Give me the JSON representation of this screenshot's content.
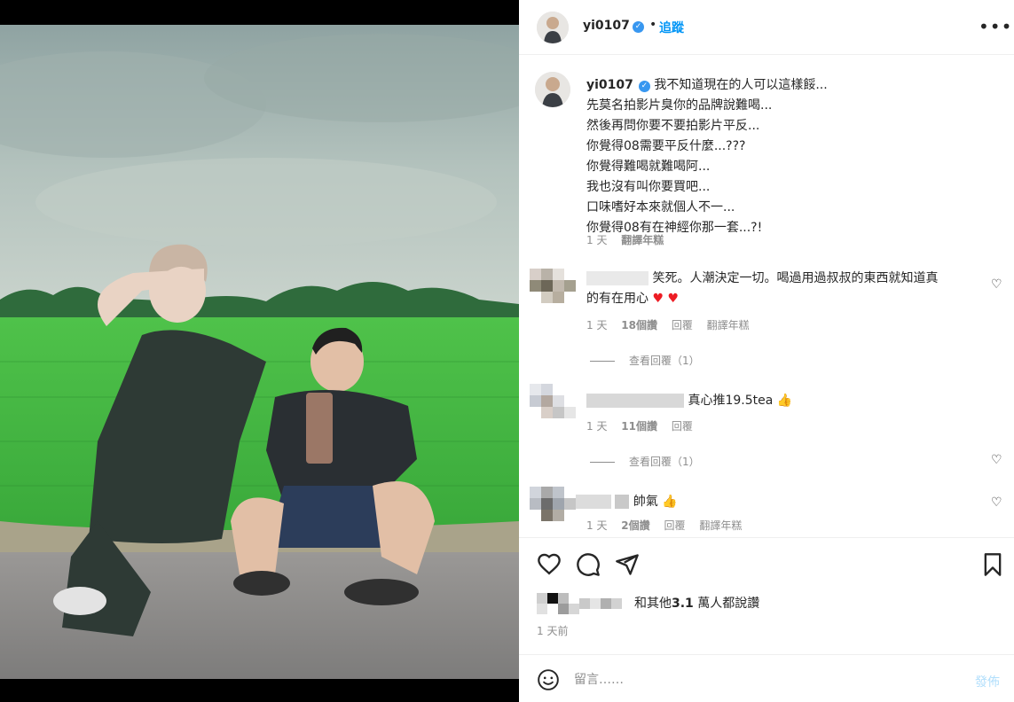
{
  "header": {
    "username": "yi0107",
    "verified_glyph": "✓",
    "separator": "•",
    "follow_label": "追蹤",
    "more_glyph": "•••"
  },
  "caption": {
    "username": "yi0107",
    "lines": [
      "我不知道現在的人可以這樣餒...",
      "先莫名拍影片臭你的品牌說難喝...",
      "然後再問你要不要拍影片平反...",
      "你覺得08需要平反什麼...???",
      "你覺得難喝就難喝阿...",
      "我也沒有叫你要買吧...",
      "口味嗜好本來就個人不一...",
      "你覺得08有在神經你那一套...?!"
    ],
    "age": "1 天",
    "translate": "翻譯年糕"
  },
  "comments": [
    {
      "text_line1": "笑死。人潮決定一切。喝過用過叔叔的東西就知道真",
      "text_line2": "的有在用心",
      "hearts": "♥ ♥",
      "age": "1 天",
      "likes": "18個讚",
      "reply": "回覆",
      "translate": "翻譯年糕",
      "view_replies": "查看回覆（1）"
    },
    {
      "text": "真心推19.5tea",
      "emoji": "👍",
      "age": "1 天",
      "likes": "11個讚",
      "reply": "回覆",
      "view_replies": "查看回覆（1）"
    },
    {
      "text": "帥氣",
      "emoji": "👍",
      "age": "1 天",
      "likes": "2個讚",
      "reply": "回覆",
      "translate": "翻譯年糕"
    }
  ],
  "likes_summary": {
    "prefix": "和其他",
    "count": "3.1",
    "suffix": " 萬人都說讚"
  },
  "post_time": "1 天前",
  "composer": {
    "placeholder": "留言……",
    "post_label": "發佈"
  },
  "icons": {
    "like": "heart-icon",
    "comment": "comment-icon",
    "share": "share-icon",
    "save": "bookmark-icon",
    "emoji": "emoji-icon"
  },
  "colors": {
    "accent": "#0095f6",
    "verified": "#3897f0",
    "muted": "#8e8e8e",
    "heart": "#ed1c24"
  }
}
